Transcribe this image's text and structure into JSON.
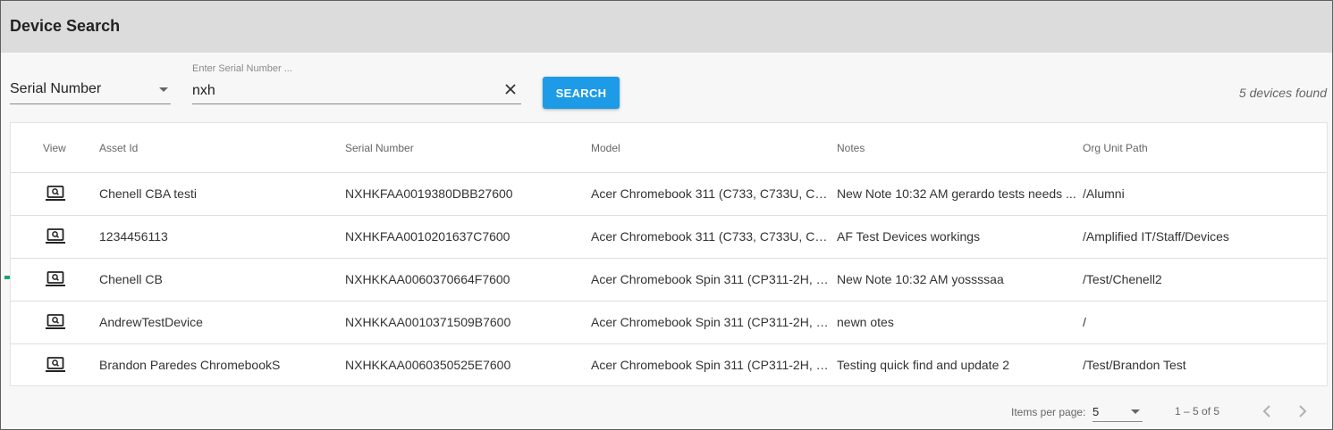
{
  "title": "Device Search",
  "search": {
    "field_select": "Serial Number",
    "input_label": "Enter Serial Number ...",
    "input_value": "nxh",
    "button_label": "SEARCH",
    "result_count": "5 devices found"
  },
  "table": {
    "headers": [
      "View",
      "Asset Id",
      "Serial Number",
      "Model",
      "Notes",
      "Org Unit Path"
    ],
    "rows": [
      {
        "asset_id": "Chenell CBA testi",
        "serial": "NXHKFAA0019380DBB27600",
        "model": "Acer Chromebook 311 (C733, C733U, C7...",
        "notes": "New Note 10:32 AM gerardo tests needs ...",
        "org_unit": "/Alumni"
      },
      {
        "asset_id": "1234456113",
        "serial": "NXHKFAA0010201637C7600",
        "model": "Acer Chromebook 311 (C733, C733U, C7...",
        "notes": "AF Test Devices workings",
        "org_unit": "/Amplified IT/Staff/Devices"
      },
      {
        "asset_id": "Chenell CB",
        "serial": "NXHKKAA0060370664F7600",
        "model": "Acer Chromebook Spin 311 (CP311-2H, C...",
        "notes": "New Note 10:32 AM yossssaa",
        "org_unit": "/Test/Chenell2"
      },
      {
        "asset_id": "AndrewTestDevice",
        "serial": "NXHKKAA0010371509B7600",
        "model": "Acer Chromebook Spin 311 (CP311-2H, C...",
        "notes": "newn otes",
        "org_unit": "/"
      },
      {
        "asset_id": "Brandon Paredes ChromebookS",
        "serial": "NXHKKAA0060350525E7600",
        "model": "Acer Chromebook Spin 311 (CP311-2H, C...",
        "notes": "Testing quick find and update 2",
        "org_unit": "/Test/Brandon Test"
      }
    ]
  },
  "paginator": {
    "items_per_page_label": "Items per page:",
    "items_per_page": "5",
    "range": "1 – 5 of 5"
  },
  "icons": {
    "view": "laptop-search-icon",
    "clear": "close-icon",
    "prev": "chevron-left-icon",
    "next": "chevron-right-icon",
    "annotation": "arrow-right-icon"
  },
  "colors": {
    "accent": "#1e9be6",
    "annotation_arrow": "#1aa37a",
    "header_bg": "#dcdcdc"
  }
}
